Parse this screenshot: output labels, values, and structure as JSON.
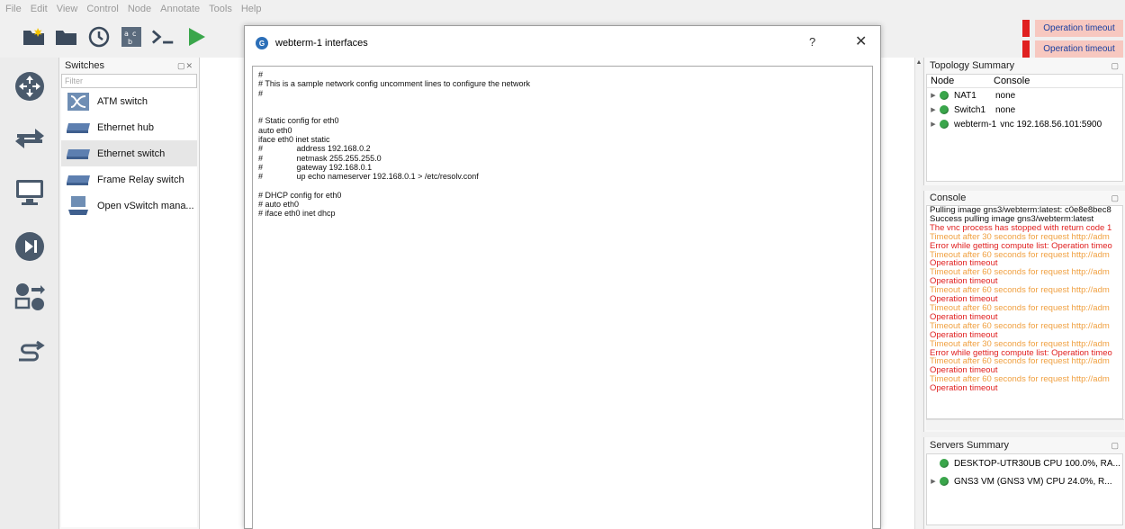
{
  "menu": [
    "File",
    "Edit",
    "View",
    "Control",
    "Node",
    "Annotate",
    "Tools",
    "Help"
  ],
  "notifications": [
    "Operation timeout",
    "Operation timeout"
  ],
  "switches_panel": {
    "title": "Switches",
    "filter_placeholder": "Filter",
    "items": [
      {
        "label": "ATM switch",
        "icon": "atm-switch-icon"
      },
      {
        "label": "Ethernet hub",
        "icon": "ethernet-hub-icon"
      },
      {
        "label": "Ethernet switch",
        "icon": "ethernet-switch-icon"
      },
      {
        "label": "Frame Relay switch",
        "icon": "frame-relay-switch-icon"
      },
      {
        "label": "Open vSwitch mana...",
        "icon": "open-vswitch-icon"
      }
    ]
  },
  "dialog": {
    "title": "webterm-1 interfaces",
    "help": "?",
    "close": "✕",
    "config_text": "#\n# This is a sample network config uncomment lines to configure the network\n#\n\n\n# Static config for eth0\nauto eth0\niface eth0 inet static\n#               address 192.168.0.2\n#               netmask 255.255.255.0\n#               gateway 192.168.0.1\n#               up echo nameserver 192.168.0.1 > /etc/resolv.conf\n\n# DHCP config for eth0\n# auto eth0\n# iface eth0 inet dhcp"
  },
  "topology_summary": {
    "title": "Topology Summary",
    "col_node": "Node",
    "col_console": "Console",
    "rows": [
      {
        "node": "NAT1",
        "console": "none"
      },
      {
        "node": "Switch1",
        "console": "none"
      },
      {
        "node": "webterm-1",
        "console": "vnc 192.168.56.101:5900"
      }
    ]
  },
  "console": {
    "title": "Console",
    "lines": [
      {
        "text": "Pulling image gns3/webterm:latest: c0e8e8bec8",
        "color": "black"
      },
      {
        "text": "Success pulling image gns3/webterm:latest",
        "color": "black"
      },
      {
        "text": "The vnc process has stopped with return code 1",
        "color": "red"
      },
      {
        "text": "Timeout after 30 seconds for request http://adm",
        "color": "orange"
      },
      {
        "text": "Error while getting compute list: Operation timeo",
        "color": "red"
      },
      {
        "text": "Timeout after 60 seconds for request http://adm",
        "color": "orange"
      },
      {
        "text": "Operation timeout",
        "color": "red"
      },
      {
        "text": "Timeout after 60 seconds for request http://adm",
        "color": "orange"
      },
      {
        "text": "Operation timeout",
        "color": "red"
      },
      {
        "text": "Timeout after 60 seconds for request http://adm",
        "color": "orange"
      },
      {
        "text": "Operation timeout",
        "color": "red"
      },
      {
        "text": "Timeout after 60 seconds for request http://adm",
        "color": "orange"
      },
      {
        "text": "Operation timeout",
        "color": "red"
      },
      {
        "text": "Timeout after 60 seconds for request http://adm",
        "color": "orange"
      },
      {
        "text": "Operation timeout",
        "color": "red"
      },
      {
        "text": "Timeout after 30 seconds for request http://adm",
        "color": "orange"
      },
      {
        "text": "Error while getting compute list: Operation timeo",
        "color": "red"
      },
      {
        "text": "Timeout after 60 seconds for request http://adm",
        "color": "orange"
      },
      {
        "text": "Operation timeout",
        "color": "red"
      },
      {
        "text": "Timeout after 60 seconds for request http://adm",
        "color": "orange"
      },
      {
        "text": "Operation timeout",
        "color": "red"
      }
    ]
  },
  "servers_summary": {
    "title": "Servers Summary",
    "rows": [
      {
        "text": "DESKTOP-UTR30UB CPU 100.0%, RA..."
      },
      {
        "text": "GNS3 VM (GNS3 VM) CPU 24.0%, R..."
      }
    ]
  },
  "colors": {
    "status_green": "#3aa64b",
    "error_red": "#e02020",
    "warning_orange": "#f0a040",
    "notif_bg": "#f7c8c0"
  }
}
